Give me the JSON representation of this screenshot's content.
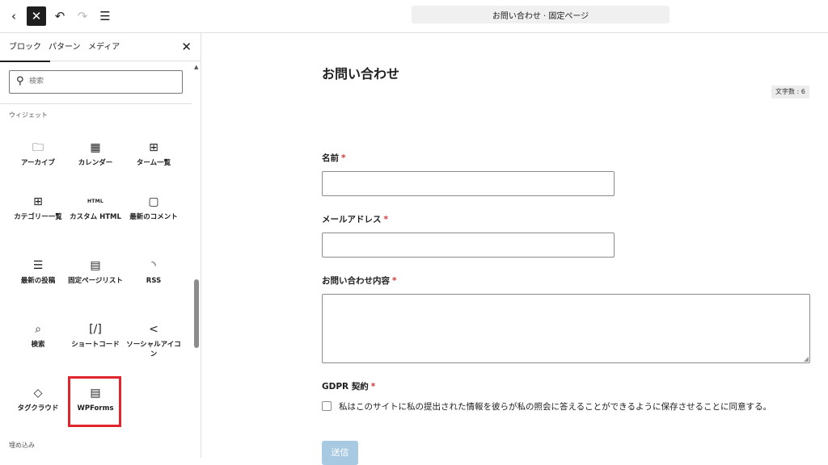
{
  "toolbar": {
    "back_icon": "‹",
    "close_icon": "✕",
    "undo_icon": "↶",
    "redo_icon": "↷",
    "list_icon": "☰",
    "document_title": "お問い合わせ · 固定ページ"
  },
  "inserter": {
    "tabs": [
      {
        "label": "ブロック"
      },
      {
        "label": "パターン"
      },
      {
        "label": "メディア"
      }
    ],
    "close_icon": "✕",
    "search": {
      "placeholder": "検索",
      "value": ""
    },
    "widgets_label": "ウィジェット",
    "embeds_label": "埋め込み",
    "blocks": [
      {
        "label": "アーカイブ",
        "icon": "🗀"
      },
      {
        "label": "カレンダー",
        "icon": "▦"
      },
      {
        "label": "ターム一覧",
        "icon": "⊞"
      },
      {
        "label": "カテゴリー一覧",
        "icon": "⊞"
      },
      {
        "label": "カスタム HTML",
        "icon": "HTML"
      },
      {
        "label": "最新のコメント",
        "icon": "▢"
      },
      {
        "label": "最新の投稿",
        "icon": "☰"
      },
      {
        "label": "固定ページリスト",
        "icon": "▤"
      },
      {
        "label": "RSS",
        "icon": "◝"
      },
      {
        "label": "検索",
        "icon": "⌕"
      },
      {
        "label": "ショートコード",
        "icon": "[/]"
      },
      {
        "label": "ソーシャルアイコン",
        "icon": "<"
      },
      {
        "label": "タグクラウド",
        "icon": "◇"
      },
      {
        "label": "WPForms",
        "icon": "▤"
      }
    ]
  },
  "editor": {
    "page_title": "お問い合わせ",
    "char_count": "文字数 : 6",
    "fields": {
      "name_label": "名前",
      "email_label": "メールアドレス",
      "message_label": "お問い合わせ内容",
      "gdpr_label": "GDPR 契約",
      "required_mark": "*"
    },
    "gdpr_text": "私はこのサイトに私の提出された情報を彼らが私の照会に答えることができるように保存させることに同意する。",
    "submit_label": "送信"
  }
}
